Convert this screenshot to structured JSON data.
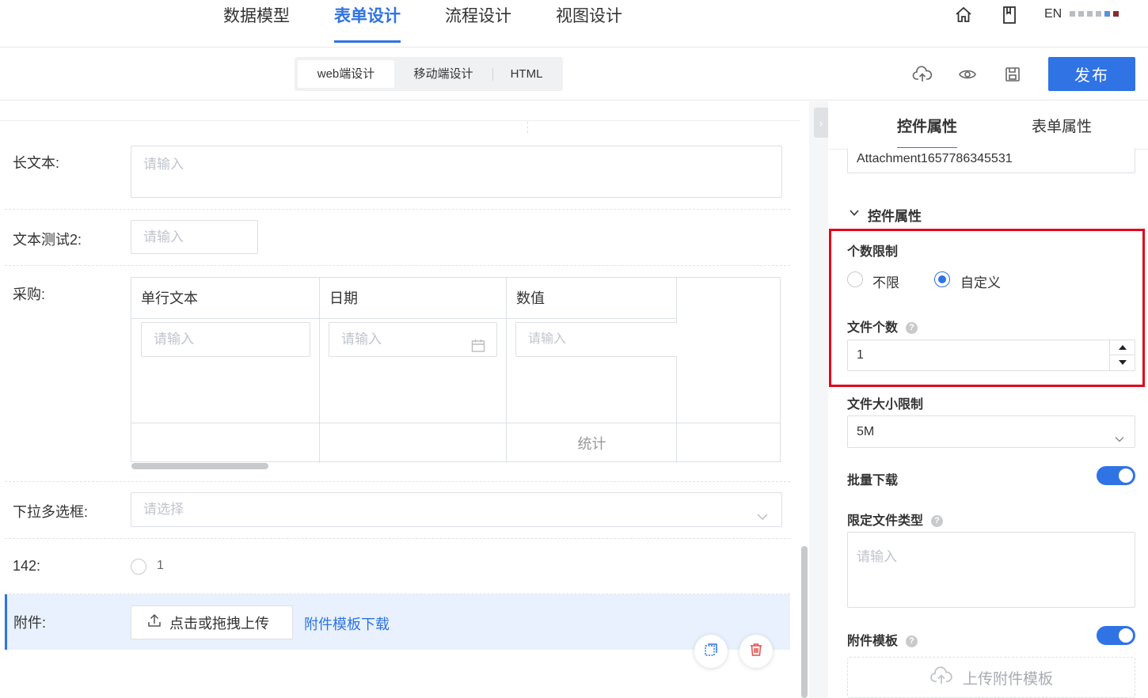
{
  "top_nav": {
    "tabs": [
      {
        "label": "数据模型"
      },
      {
        "label": "表单设计"
      },
      {
        "label": "流程设计"
      },
      {
        "label": "视图设计"
      }
    ],
    "active_tab": "表单设计",
    "lang": "EN",
    "icons": [
      "home-icon",
      "book-icon"
    ]
  },
  "toolbar": {
    "segments": [
      {
        "label": "web端设计"
      },
      {
        "label": "移动端设计"
      },
      {
        "label": "HTML"
      }
    ],
    "active_segment": "web端设计",
    "icons": [
      "cloud-upload-icon",
      "eye-icon",
      "save-icon"
    ],
    "publish_label": "发布"
  },
  "form": {
    "long_text": {
      "label": "长文本:",
      "placeholder": "请输入"
    },
    "text_test2": {
      "label": "文本测试2:",
      "placeholder": "请输入"
    },
    "purchase": {
      "label": "采购:",
      "columns": [
        {
          "header": "单行文本",
          "placeholder": "请输入"
        },
        {
          "header": "日期",
          "placeholder": "请输入"
        },
        {
          "header": "数值",
          "placeholder": "请输入"
        }
      ],
      "summary_label": "统计"
    },
    "multi_select": {
      "label": "下拉多选框:",
      "placeholder": "请选择"
    },
    "field_142": {
      "label": "142:",
      "option": "1"
    },
    "attachment": {
      "label": "附件:",
      "upload_label": "点击或拖拽上传",
      "template_link": "附件模板下载"
    }
  },
  "panel": {
    "tabs": [
      {
        "label": "控件属性"
      },
      {
        "label": "表单属性"
      }
    ],
    "active_tab": "控件属性",
    "field_id": "Attachment1657786345531",
    "section_title": "控件属性",
    "count_limit": {
      "label": "个数限制",
      "options": [
        {
          "label": "不限",
          "checked": false
        },
        {
          "label": "自定义",
          "checked": true
        }
      ]
    },
    "file_count": {
      "label": "文件个数",
      "value": "1"
    },
    "file_size": {
      "label": "文件大小限制",
      "value": "5M"
    },
    "batch_download": {
      "label": "批量下载",
      "enabled": true
    },
    "file_types": {
      "label": "限定文件类型",
      "placeholder": "请输入"
    },
    "attachment_template": {
      "label": "附件模板",
      "enabled": true
    },
    "upload_template_label": "上传附件模板"
  },
  "colors": {
    "accent": "#2f73e5",
    "highlight": "#e0061a",
    "delete": "#e34d4d"
  }
}
